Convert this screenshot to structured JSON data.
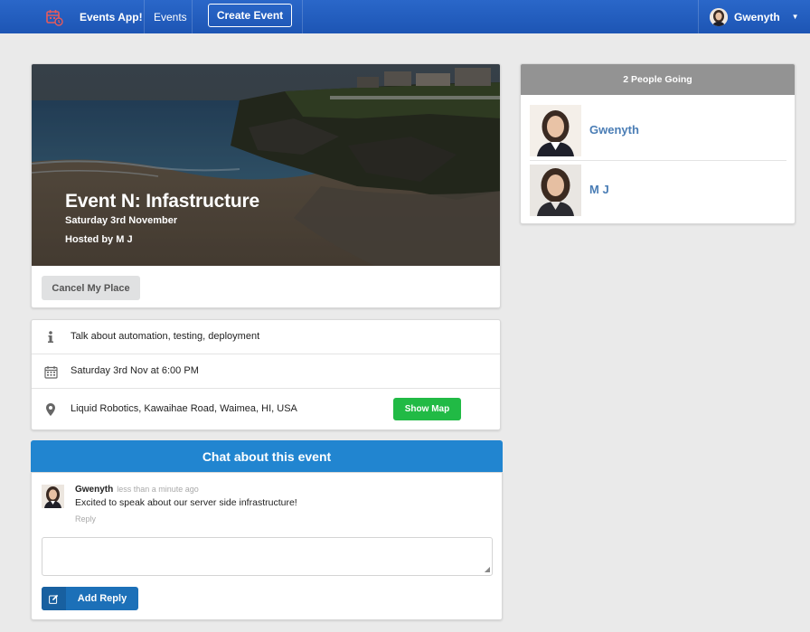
{
  "nav": {
    "brand": "Events App!",
    "events_link": "Events",
    "create_button": "Create Event",
    "user_name": "Gwenyth"
  },
  "event": {
    "title": "Event N: Infastructure",
    "date": "Saturday 3rd November",
    "hosted_by": "Hosted by M J",
    "cancel_button": "Cancel My Place"
  },
  "details": {
    "description": "Talk about automation, testing, deployment",
    "datetime": "Saturday 3rd Nov at 6:00 PM",
    "location": "Liquid Robotics, Kawaihae Road, Waimea, HI, USA",
    "show_map_button": "Show Map"
  },
  "chat": {
    "header": "Chat about this event",
    "comments": [
      {
        "author": "Gwenyth",
        "time": "less than a minute ago",
        "text": "Excited to speak about our server side infrastructure!",
        "reply_label": "Reply"
      }
    ],
    "reply_box_value": "",
    "add_reply_button": "Add Reply"
  },
  "attendees": {
    "header": "2 People Going",
    "people": [
      {
        "name": "Gwenyth"
      },
      {
        "name": "M J"
      }
    ]
  },
  "colors": {
    "nav": "#1d55b4",
    "chat_header": "#2185d0",
    "map_button": "#21ba45",
    "attendee_link": "#4a7db5"
  },
  "icons": {
    "logo": "calendar-clock-icon",
    "description": "info-icon",
    "datetime": "calendar-icon",
    "location": "map-marker-icon",
    "reply_button": "edit-icon",
    "user_menu": "caret-down-icon"
  }
}
